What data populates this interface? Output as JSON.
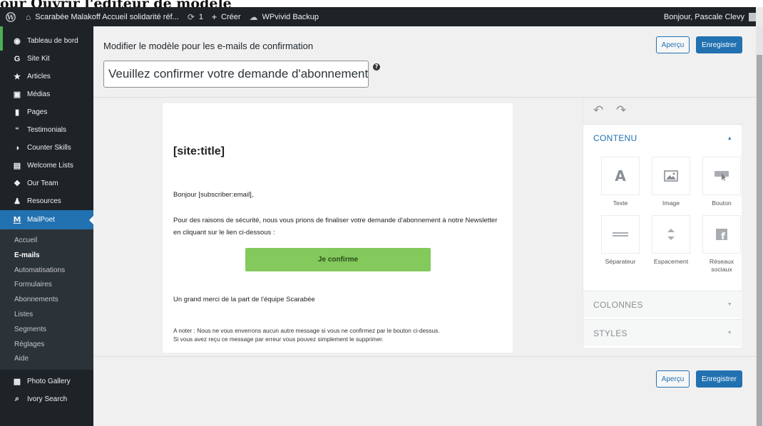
{
  "heading_strip": "our Ouvrir l'éditeur de modèle",
  "adminbar": {
    "site_name": "Scarabée Malakoff Accueil solidarité réf...",
    "updates_count": "1",
    "new_label": "Créer",
    "backup_label": "WPvivid Backup",
    "greeting": "Bonjour, Pascale Clevy"
  },
  "sidebar": {
    "items_top": [
      {
        "label": "Tableau de bord",
        "icon": "palette-icon"
      },
      {
        "label": "Site Kit",
        "icon": "google-g-icon"
      },
      {
        "label": "Articles",
        "icon": "pushpin-icon"
      },
      {
        "label": "Médias",
        "icon": "media-icon"
      },
      {
        "label": "Pages",
        "icon": "page-icon"
      },
      {
        "label": "Testimonials",
        "icon": "quote-icon"
      },
      {
        "label": "Counter Skills",
        "icon": "gauge-icon"
      },
      {
        "label": "Welcome Lists",
        "icon": "list-icon"
      },
      {
        "label": "Our Team",
        "icon": "team-icon"
      },
      {
        "label": "Resources",
        "icon": "users-icon"
      }
    ],
    "active_item": {
      "label": "MailPoet",
      "icon": "mailpoet-icon"
    },
    "submenu": [
      "Accueil",
      "E-mails",
      "Automatisations",
      "Formulaires",
      "Abonnements",
      "Listes",
      "Segments",
      "Réglages",
      "Aide"
    ],
    "submenu_current": "E-mails",
    "items_bottom": [
      {
        "label": "Photo Gallery",
        "icon": "gallery-icon"
      },
      {
        "label": "Ivory Search",
        "icon": "search-icon"
      }
    ]
  },
  "editor": {
    "page_title": "Modifier le modèle pour les e-mails de confirmation",
    "subject_value": "Veuillez confirmer votre demande d'abonnement",
    "help_glyph": "?",
    "preview_label": "Aperçu",
    "save_label": "Enregistrer"
  },
  "email": {
    "title": "[site:title]",
    "greeting": "Bonjour [subscriber:email],",
    "body": "Pour des raisons de sécurité, nous vous prions de finaliser votre demande d'abonnement à notre Newsletter en cliquant sur le lien ci-dessous :",
    "cta_label": "Je confirme",
    "thanks": "Un grand merci de la part de l'équipe Scarabée",
    "note_line1": "A noter : Nous ne vous enverrons aucun autre message si vous ne confirmez par le bouton ci-dessus.",
    "note_line2": "Si vous avez reçu ce message par erreur vous pouvez simplement le supprimer."
  },
  "panel": {
    "content_header": "CONTENU",
    "columns_header": "COLONNES",
    "styles_header": "STYLES",
    "blocks": [
      {
        "label": "Texte",
        "icon": "text-block-icon"
      },
      {
        "label": "Image",
        "icon": "image-block-icon"
      },
      {
        "label": "Bouton",
        "icon": "button-block-icon"
      },
      {
        "label": "Séparateur",
        "icon": "divider-block-icon"
      },
      {
        "label": "Espacement",
        "icon": "spacer-block-icon"
      },
      {
        "label": "Réseaux sociaux",
        "icon": "social-block-icon"
      }
    ]
  },
  "colors": {
    "admin_dark": "#1d2327",
    "accent_blue": "#2271b1",
    "cta_green": "#83c95c"
  }
}
